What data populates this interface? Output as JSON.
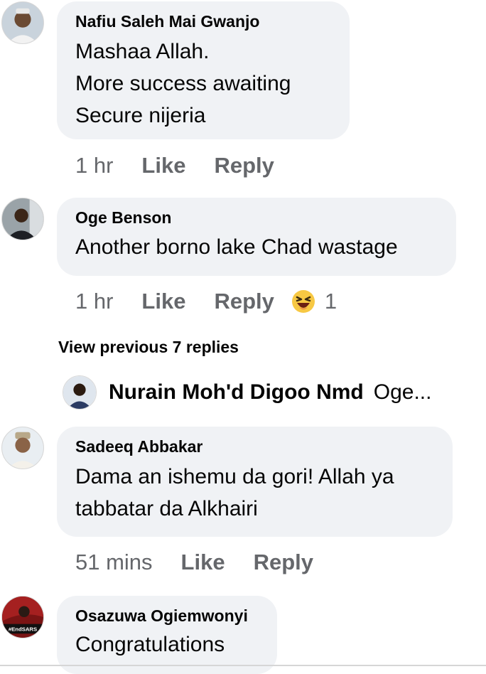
{
  "colors": {
    "bubble": "#f0f2f5",
    "meta_text": "#65676b",
    "text": "#050505"
  },
  "comments": [
    {
      "author": "Nafiu Saleh Mai Gwanjo",
      "lines": [
        "Mashaa Allah.",
        "More success awaiting",
        "Secure nijeria"
      ],
      "time": "1 hr",
      "like": "Like",
      "reply": "Reply"
    },
    {
      "author": "Oge Benson",
      "lines": [
        "Another borno lake Chad wastage"
      ],
      "time": "1 hr",
      "like": "Like",
      "reply": "Reply",
      "reaction": {
        "icon": "laughing-emoji-icon",
        "count": "1"
      }
    },
    {
      "author": "Sadeeq Abbakar",
      "lines": [
        "Dama an ishemu da gori! Allah ya",
        "tabbatar da Alkhairi"
      ],
      "time": "51 mins",
      "like": "Like",
      "reply": "Reply"
    },
    {
      "author": "Osazuwa Ogiemwonyi",
      "lines": [
        "Congratulations"
      ],
      "avatar_text": "#EndSARS"
    }
  ],
  "view_previous": "View previous 7 replies",
  "reply_preview": {
    "name": "Nurain Moh'd Digoo Nmd",
    "snippet": "Oge..."
  }
}
